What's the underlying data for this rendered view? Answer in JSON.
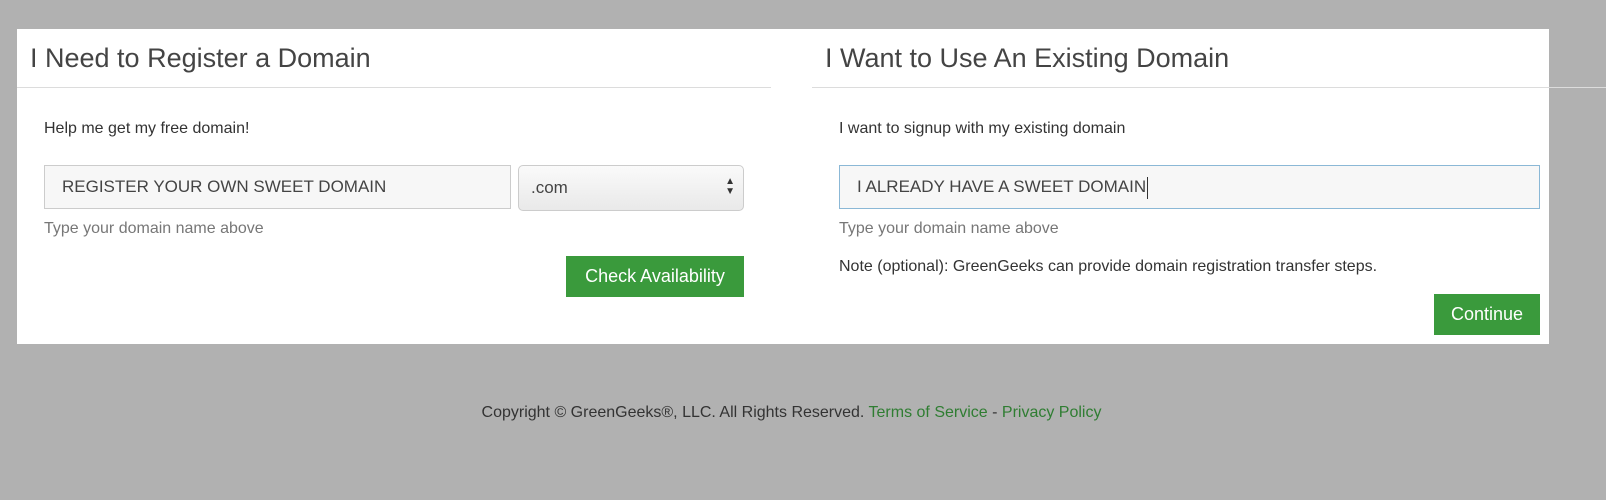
{
  "register": {
    "title": "I Need to Register a Domain",
    "lead": "Help me get my free domain!",
    "domain_input_value": "REGISTER YOUR OWN SWEET DOMAIN",
    "tld_selected": ".com",
    "help": "Type your domain name above",
    "check_button": "Check Availability"
  },
  "existing": {
    "title": "I Want to Use An Existing Domain",
    "lead": "I want to signup with my existing domain",
    "domain_input_value": "I ALREADY HAVE A SWEET DOMAIN",
    "help": "Type your domain name above",
    "note": "Note (optional): GreenGeeks can provide domain registration transfer steps.",
    "continue_button": "Continue"
  },
  "footer": {
    "copyright": "Copyright © GreenGeeks®, LLC. All Rights Reserved.",
    "terms": "Terms of Service",
    "separator": "-",
    "privacy": "Privacy Policy"
  },
  "colors": {
    "accent": "#3a9a3c",
    "link": "#2f7d32",
    "background": "#b1b1b1"
  }
}
